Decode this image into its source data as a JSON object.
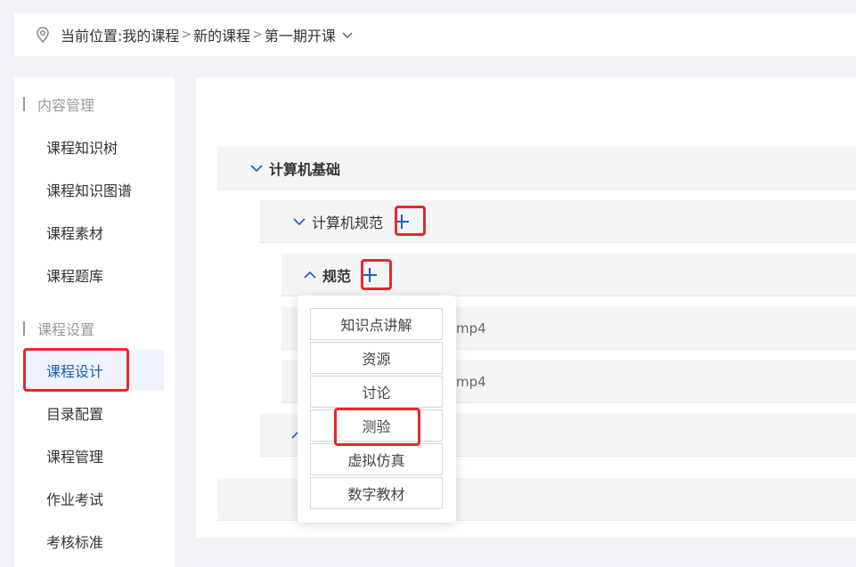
{
  "breadcrumb": {
    "label": "当前位置:",
    "items": [
      "我的课程",
      "新的课程",
      "第一期开课"
    ],
    "separator": ">"
  },
  "sidebar": {
    "section1_title": "内容管理",
    "section1_items": [
      "课程知识树",
      "课程知识图谱",
      "课程素材",
      "课程题库"
    ],
    "section2_title": "课程设置",
    "section2_items": [
      "课程设计",
      "目录配置",
      "课程管理",
      "作业考试",
      "考核标准"
    ],
    "active_item": "课程设计"
  },
  "tree": {
    "level1": "计算机基础",
    "level2": "计算机规范",
    "level3": "规范",
    "file1_suffix": "mp4",
    "file2_suffix": "mp4"
  },
  "dropdown": {
    "items": [
      "知识点讲解",
      "资源",
      "讨论",
      "测验",
      "虚拟仿真",
      "数字教材"
    ],
    "highlighted": "测验"
  },
  "colors": {
    "accent": "#1f5eb8",
    "highlight": "#e8282b",
    "active_bg": "#eef3fe"
  }
}
